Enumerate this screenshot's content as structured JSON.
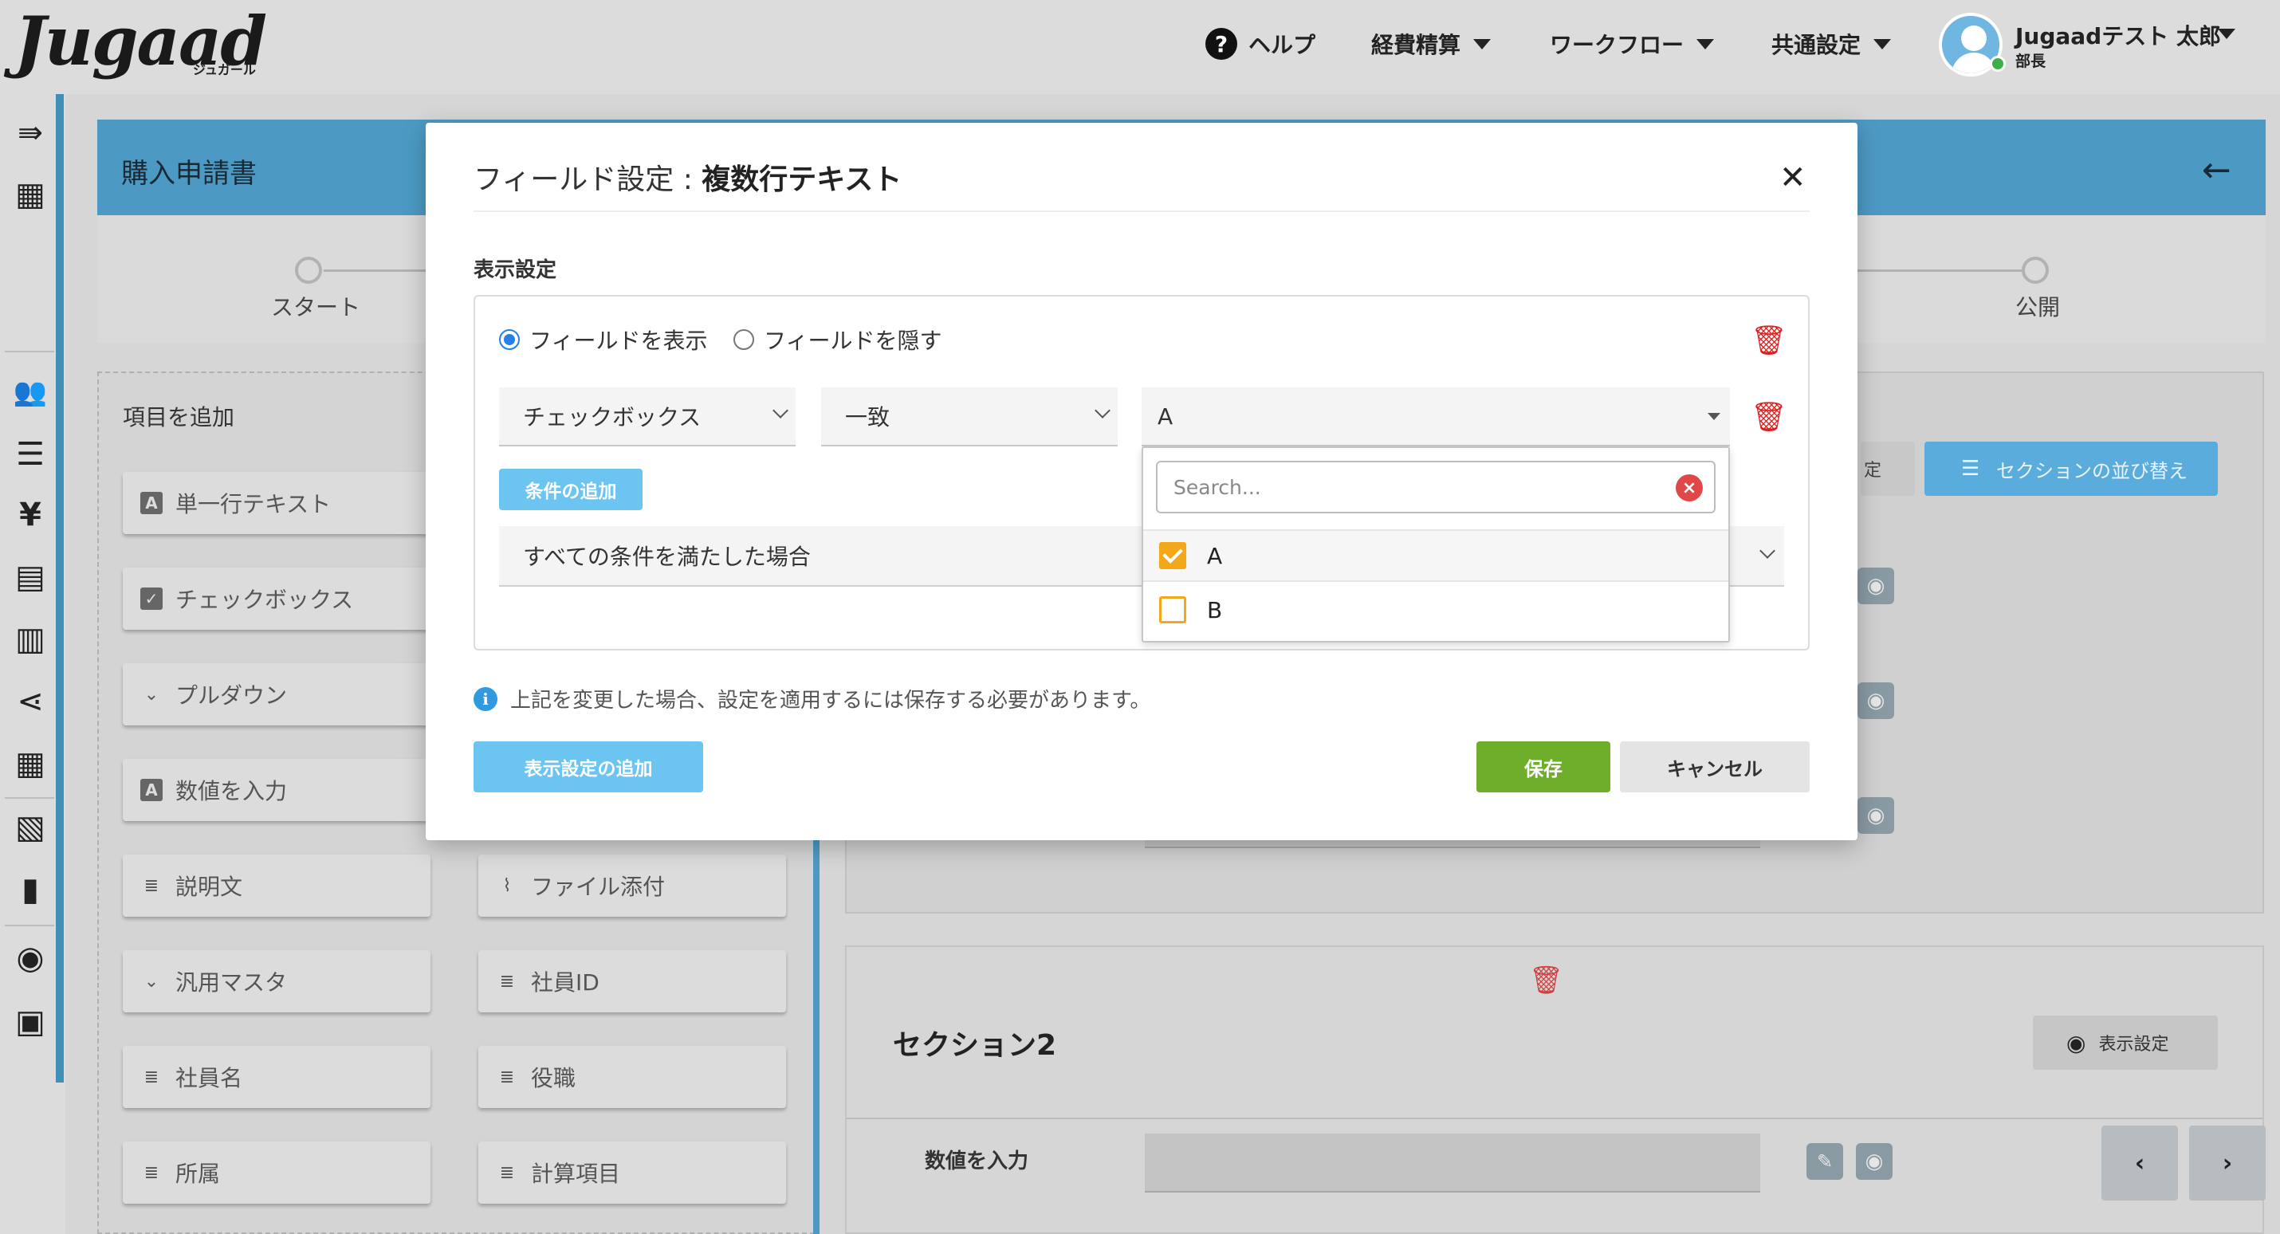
{
  "header": {
    "logo": "Jugaad",
    "logo_sub": "ジュガール",
    "nav": [
      {
        "label": "ヘルプ"
      },
      {
        "label": "経費精算"
      },
      {
        "label": "ワークフロー"
      },
      {
        "label": "共通設定"
      }
    ],
    "user": {
      "name": "Jugaadテスト 太郎",
      "role": "部長"
    }
  },
  "sidebar": {
    "icons": [
      "menu-collapse-icon",
      "building-icon",
      "users-icon",
      "list-icon",
      "yen-icon",
      "receipt-icon",
      "document-icon",
      "share-icon",
      "grid-icon",
      "library-icon",
      "file-icon",
      "palette-icon",
      "wallet-icon"
    ]
  },
  "page": {
    "title": "購入申請書",
    "steps": [
      {
        "label": "スタート"
      },
      {
        "label": "公開"
      }
    ],
    "palette_title": "項目を追加",
    "palette_items": [
      {
        "label": "単一行テキスト",
        "icon": "text-box-icon"
      },
      {
        "label": "チェックボックス",
        "icon": "checkbox-icon"
      },
      {
        "label": "プルダウン",
        "icon": "chevron-down-icon"
      },
      {
        "label": "数値を入力",
        "icon": "text-box-icon"
      },
      {
        "label": "説明文",
        "icon": "lines-icon"
      },
      {
        "label": "ファイル添付",
        "icon": "paperclip-icon"
      },
      {
        "label": "汎用マスタ",
        "icon": "chevron-down-icon"
      },
      {
        "label": "社員ID",
        "icon": "lines-icon"
      },
      {
        "label": "社員名",
        "icon": "lines-icon"
      },
      {
        "label": "役職",
        "icon": "lines-icon"
      },
      {
        "label": "所属",
        "icon": "lines-icon"
      },
      {
        "label": "計算項目",
        "icon": "lines-icon"
      }
    ],
    "bg_button_fragment": "定",
    "sort_sections_label": "セクションの並び替え",
    "section2": {
      "title": "セクション2",
      "display_settings_label": "表示設定",
      "field_label": "数値を入力"
    }
  },
  "modal": {
    "title_prefix": "フィールド設定 : ",
    "title_bold": "複数行テキスト",
    "display_section_label": "表示設定",
    "radio_show": "フィールドを表示",
    "radio_hide": "フィールドを隠す",
    "condition": {
      "field_select": "チェックボックス",
      "operator_select": "一致",
      "value_select": "A"
    },
    "add_condition_label": "条件の追加",
    "all_conditions_label": "すべての条件を満たした場合",
    "dropdown": {
      "search_placeholder": "Search...",
      "options": [
        {
          "label": "A",
          "checked": true
        },
        {
          "label": "B",
          "checked": false
        }
      ]
    },
    "info_text": "上記を変更した場合、設定を適用するには保存する必要があります。",
    "add_display_setting_label": "表示設定の追加",
    "save_label": "保存",
    "cancel_label": "キャンセル"
  },
  "colors": {
    "accent_blue": "#4c9ac4",
    "button_light_blue": "#6cc4f0",
    "save_green": "#6fae2a",
    "delete_red": "#e02020",
    "checkbox_orange": "#f3a81a"
  }
}
